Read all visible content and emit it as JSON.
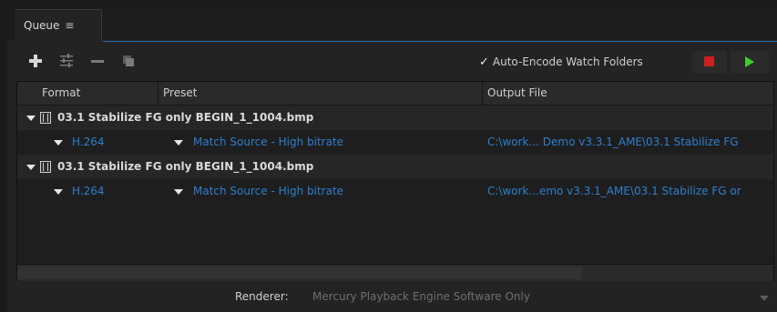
{
  "tab": {
    "label": "Queue",
    "menu_glyph": "≡"
  },
  "toolbar": {
    "icons": [
      "add-icon",
      "settings-sliders-icon",
      "remove-icon",
      "duplicate-icon"
    ],
    "auto_encode_checked": true,
    "auto_encode_check_glyph": "✓",
    "auto_encode_label": "Auto-Encode Watch Folders",
    "stop_color": "#cc1f1f",
    "play_color": "#3ecf2c"
  },
  "columns": {
    "format": "Format",
    "preset": "Preset",
    "output": "Output File"
  },
  "queue": [
    {
      "source": "03.1 Stabilize FG only BEGIN_1_1004.bmp",
      "format": "H.264",
      "preset": "Match Source - High bitrate",
      "output": "C:\\work... Demo v3.3.1_AME\\03.1 Stabilize FG"
    },
    {
      "source": "03.1 Stabilize FG only BEGIN_1_1004.bmp",
      "format": "H.264",
      "preset": "Match Source - High bitrate",
      "output": "C:\\work...emo v3.3.1_AME\\03.1 Stabilize FG or"
    }
  ],
  "renderer": {
    "label": "Renderer:",
    "value": "Mercury Playback Engine Software Only"
  },
  "colors": {
    "link_blue": "#2d7fce",
    "tab_accent": "#2b6fb4"
  }
}
